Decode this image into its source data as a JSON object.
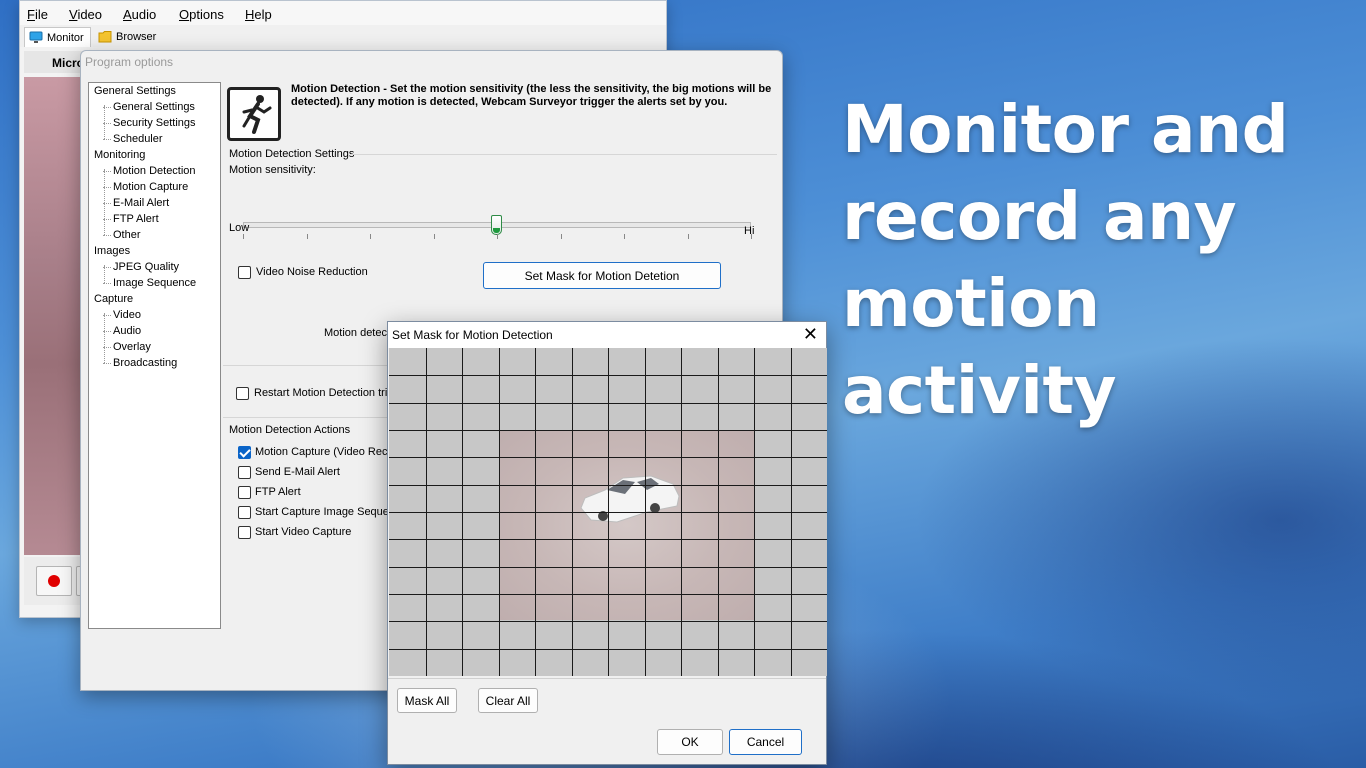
{
  "headline": {
    "lines": [
      "Monitor and",
      "record any",
      "motion activity"
    ]
  },
  "main_window": {
    "menu": [
      "File",
      "Video",
      "Audio",
      "Options",
      "Help"
    ],
    "tabs": [
      {
        "label": "Monitor",
        "icon": "monitor-icon"
      },
      {
        "label": "Browser",
        "icon": "folder-icon"
      }
    ],
    "camera_label": "Micro"
  },
  "options": {
    "title": "Program options",
    "tree": [
      {
        "label": "General Settings",
        "level": 0
      },
      {
        "label": "General Settings",
        "level": 1
      },
      {
        "label": "Security Settings",
        "level": 1
      },
      {
        "label": "Scheduler",
        "level": 1
      },
      {
        "label": "Monitoring",
        "level": 0
      },
      {
        "label": "Motion Detection",
        "level": 1
      },
      {
        "label": "Motion Capture",
        "level": 1
      },
      {
        "label": "E-Mail Alert",
        "level": 1
      },
      {
        "label": "FTP Alert",
        "level": 1
      },
      {
        "label": "Other",
        "level": 1
      },
      {
        "label": "Images",
        "level": 0
      },
      {
        "label": "JPEG Quality",
        "level": 1
      },
      {
        "label": "Image Sequence",
        "level": 1
      },
      {
        "label": "Capture",
        "level": 0
      },
      {
        "label": "Video",
        "level": 1
      },
      {
        "label": "Audio",
        "level": 1
      },
      {
        "label": "Overlay",
        "level": 1
      },
      {
        "label": "Broadcasting",
        "level": 1
      }
    ],
    "description": "Motion Detection - Set the motion sensitivity (the less the sensitivity, the big motions will be detected). If any motion is detected, Webcam Surveyor trigger the alerts set by you.",
    "settings_group": "Motion Detection Settings",
    "sensitivity_label": "Motion sensitivity:",
    "sensitivity_value": 0.5,
    "slider_low": "Low",
    "slider_high": "Hi",
    "noise_reduction_label": "Video Noise Reduction",
    "noise_reduction_checked": false,
    "set_mask_button": "Set Mask for Motion Detetion",
    "motion_detect_label": "Motion detec",
    "restart_label": "Restart Motion Detection trig",
    "restart_checked": false,
    "actions_group": "Motion Detection Actions",
    "actions": [
      {
        "label": "Motion Capture (Video Reco",
        "checked": true
      },
      {
        "label": "Send E-Mail  Alert",
        "checked": false
      },
      {
        "label": "FTP Alert",
        "checked": false
      },
      {
        "label": "Start Capture Image Seque",
        "checked": false
      },
      {
        "label": "Start Video Capture",
        "checked": false
      }
    ]
  },
  "mask_dialog": {
    "title": "Set Mask for Motion Detection",
    "close_icon": "close-icon",
    "grid_columns": 12,
    "grid_rows": 12,
    "mask_all_button": "Mask All",
    "clear_all_button": "Clear All",
    "ok_button": "OK",
    "cancel_button": "Cancel"
  }
}
